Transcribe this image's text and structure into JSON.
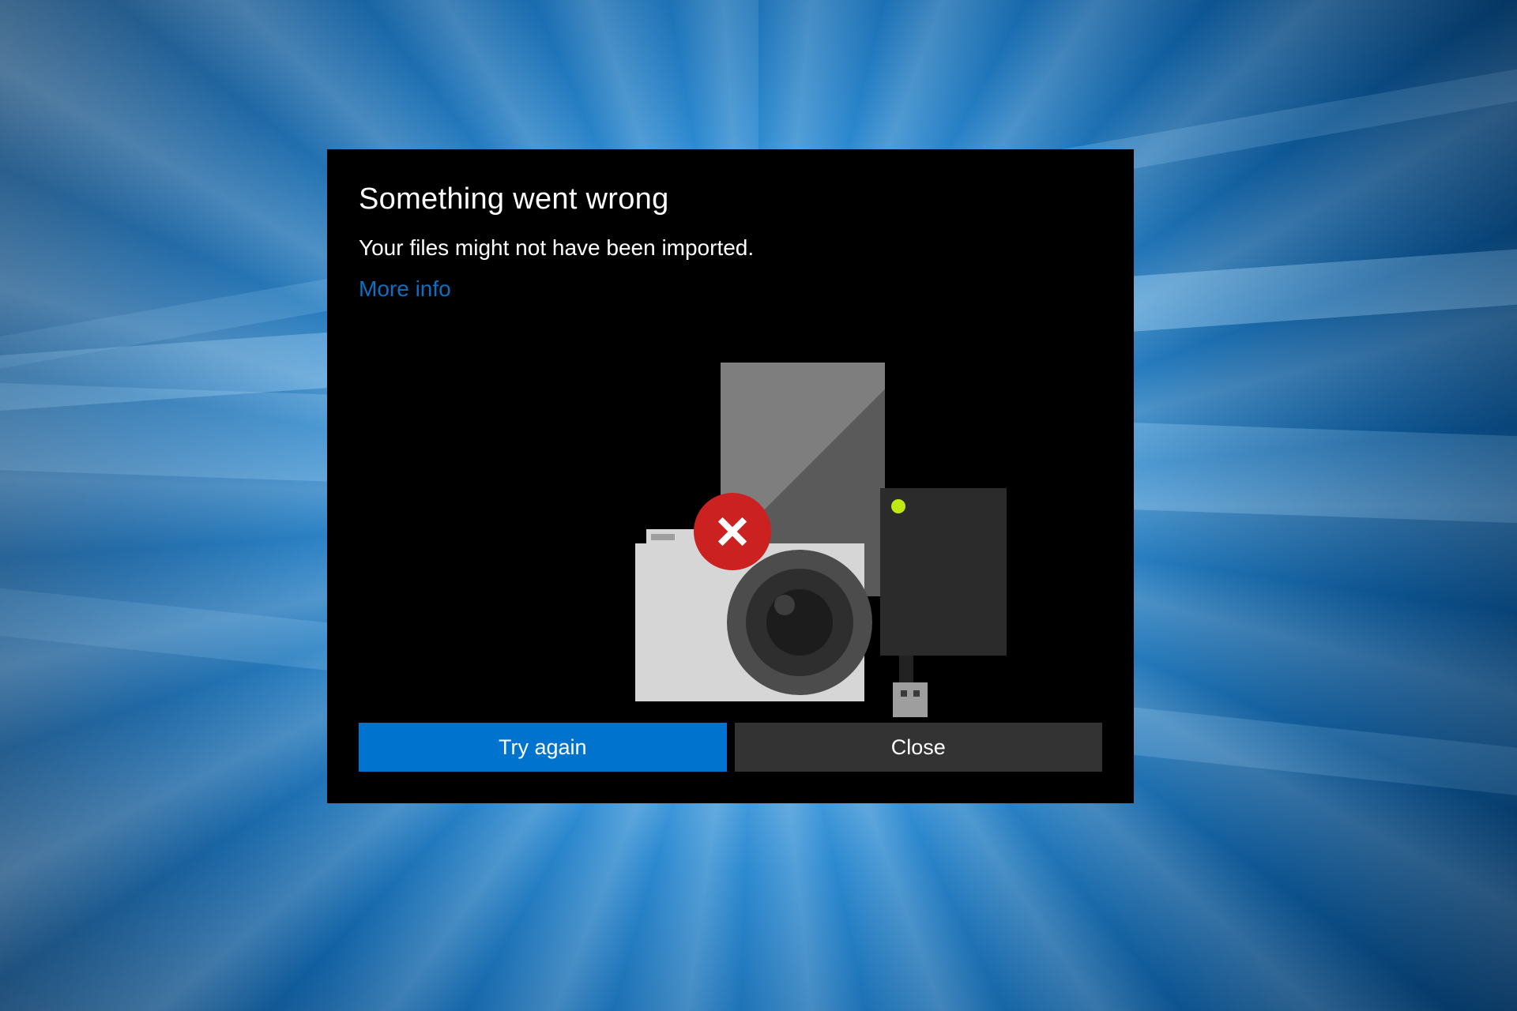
{
  "dialog": {
    "title": "Something went wrong",
    "message": "Your files might not have been imported.",
    "more_info_label": "More info",
    "buttons": {
      "primary": "Try again",
      "secondary": "Close"
    }
  },
  "colors": {
    "accent": "#0073cf",
    "error": "#cc2121",
    "link": "#0b6fc2"
  }
}
